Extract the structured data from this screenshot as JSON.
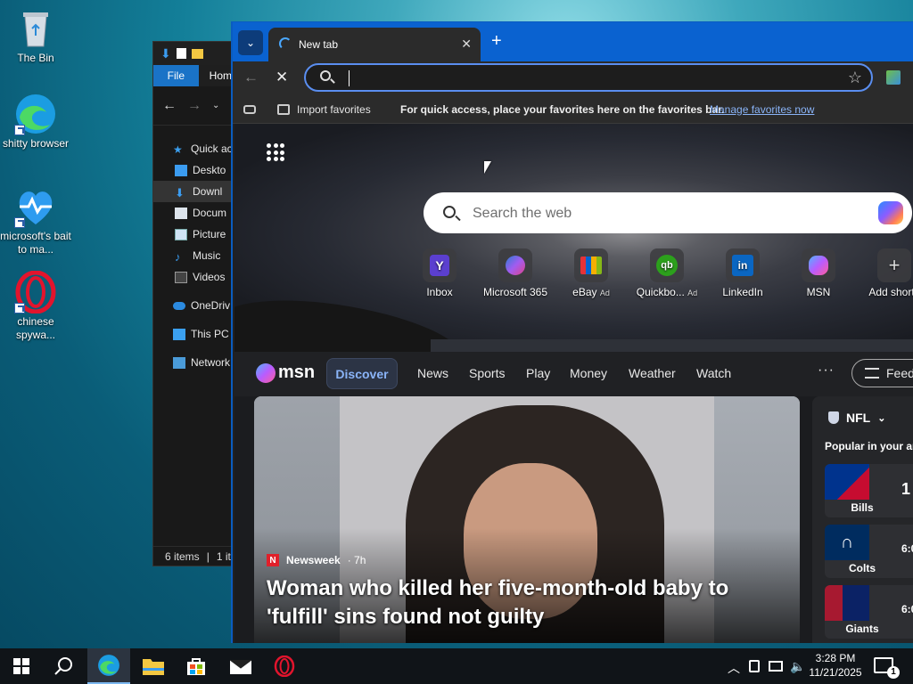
{
  "desktop": {
    "icons": [
      {
        "label": "The Bin",
        "icon": "recycle-bin-icon"
      },
      {
        "label": "shitty browser",
        "icon": "edge-icon"
      },
      {
        "label": "microsoft's bait to ma...",
        "icon": "health-icon"
      },
      {
        "label": "chinese spywa...",
        "icon": "opera-icon"
      }
    ]
  },
  "explorer": {
    "tabs": {
      "file": "File",
      "home": "Hom"
    },
    "tree": [
      "Quick ac",
      "Deskto",
      "Downl",
      "Docum",
      "Picture",
      "Music",
      "Videos",
      "OneDriv",
      "This PC",
      "Network"
    ],
    "status": {
      "items": "6 items",
      "selected": "1 it"
    }
  },
  "browser": {
    "tab_title": "New tab",
    "address_value": "",
    "favorites_bar": {
      "import": "Import favorites",
      "message": "For quick access, place your favorites here on the favorites bar.",
      "link": "Manage favorites now"
    },
    "ntp": {
      "search_placeholder": "Search the web",
      "quick_links": [
        {
          "label": "Inbox",
          "ad": ""
        },
        {
          "label": "Microsoft 365",
          "ad": ""
        },
        {
          "label": "eBay",
          "ad": "Ad"
        },
        {
          "label": "Quickbo...",
          "ad": "Ad"
        },
        {
          "label": "LinkedIn",
          "ad": ""
        },
        {
          "label": "MSN",
          "ad": ""
        },
        {
          "label": "Add shortc",
          "ad": ""
        }
      ],
      "msn": {
        "logo": "msn",
        "tabs": [
          "Discover",
          "News",
          "Sports",
          "Play",
          "Money",
          "Weather",
          "Watch"
        ],
        "more": "···",
        "feed": "Feed"
      },
      "hero": {
        "source": "Newsweek",
        "age": "· 7h",
        "headline": "Woman who killed her five-month-old baby to 'fulfill' sins found not guilty"
      },
      "sports": {
        "league": "NFL",
        "popular": "Popular in your ar",
        "teams": [
          {
            "name": "Bills",
            "score": "1",
            "color": "#00338d"
          },
          {
            "name": "Colts",
            "score": "6:0",
            "color": "#002c5f"
          },
          {
            "name": "Giants",
            "score": "6:0",
            "color": "#a71930"
          }
        ]
      }
    }
  },
  "taskbar": {
    "time": "3:28 PM",
    "date": "11/21/2025",
    "notifications": "1"
  }
}
